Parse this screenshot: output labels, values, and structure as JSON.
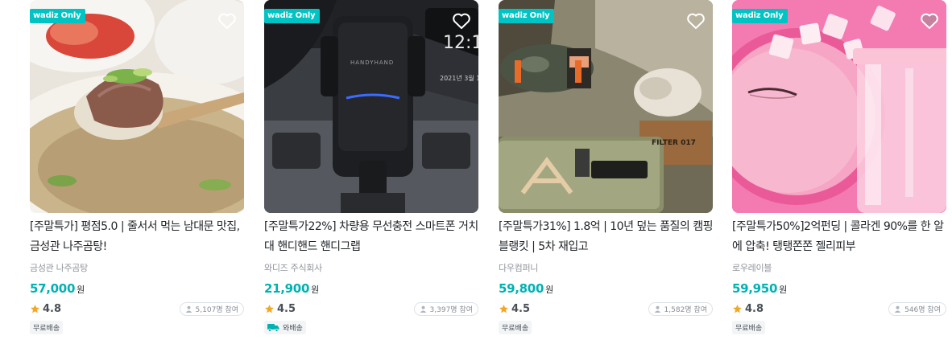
{
  "products": [
    {
      "badge": "wadiz Only",
      "title": "[주말특가] 평점5.0 | 줄서서 먹는 남대문 맛집,금성관 나주곰탕!",
      "maker": "금성관 나주곰탕",
      "price": "57,000",
      "currency": "원",
      "rating": "4.8",
      "participants": "5,107명 참여",
      "tag": "무료배송",
      "tag_icon": "none"
    },
    {
      "badge": "wadiz Only",
      "title": "[주말특가22%] 차량용 무선충전 스마트폰 거치대 핸디핸드 핸디그랩",
      "maker": "와디즈 주식회사",
      "price": "21,900",
      "currency": "원",
      "rating": "4.5",
      "participants": "3,397명 참여",
      "tag": "와배송",
      "tag_icon": "truck-icon"
    },
    {
      "badge": "wadiz Only",
      "title": "[주말특가31%] 1.8억 | 10년 덮는 품질의 캠핑 블랭킷 | 5차 재입고",
      "maker": "다우컴퍼니",
      "price": "59,800",
      "currency": "원",
      "rating": "4.5",
      "participants": "1,582명 참여",
      "tag": "무료배송",
      "tag_icon": "none"
    },
    {
      "badge": "wadiz Only",
      "title": "[주말특가50%]2억펀딩 | 콜라겐 90%를 한 알에 압축! 탱탱쫀쫀 젤리피부",
      "maker": "로우레이블",
      "price": "59,950",
      "currency": "원",
      "rating": "4.8",
      "participants": "546명 참여",
      "tag": "무료배송",
      "tag_icon": "none"
    }
  ],
  "image_text": {
    "phone_clock": "12:1",
    "phone_date": "2021년 3월 1",
    "brand_label": "HANDYHAND",
    "box_label": "FILTER 017"
  },
  "colors": {
    "price": "#00b2b2",
    "badge": "#00c4c4",
    "star": "#f5a623"
  }
}
